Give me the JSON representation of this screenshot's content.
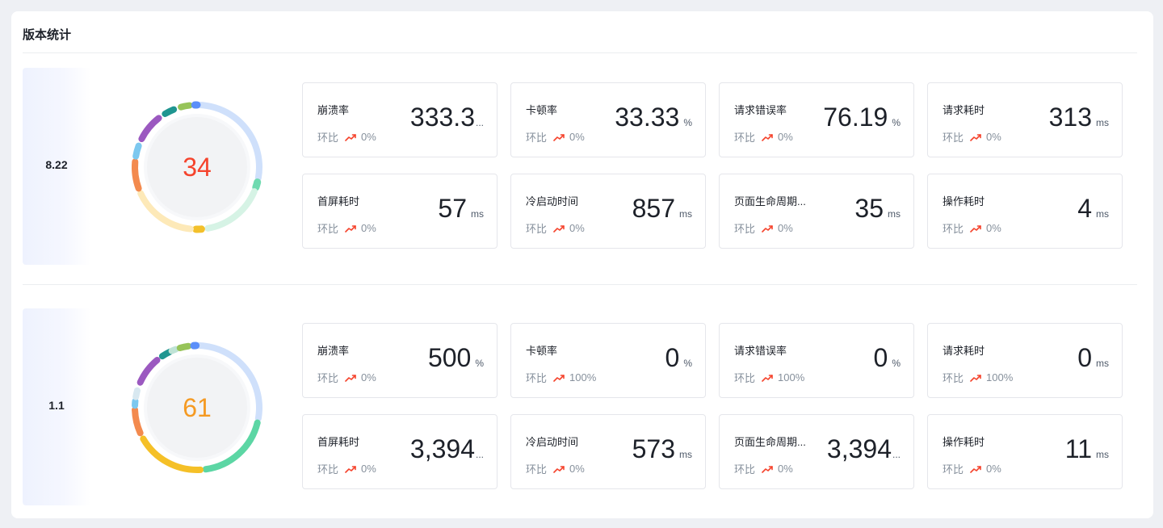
{
  "page": {
    "title": "版本统计",
    "compare_label": "环比"
  },
  "versions": [
    {
      "version": "8.22",
      "score": "34",
      "score_color": "#f5432c",
      "ring_colors": [
        "#cfe0fb",
        "#6fdab0",
        "#d6f3e5",
        "#f3c02a",
        "#fde9b8",
        "#f38a4e",
        "#7cc8ef",
        "#9b59c0",
        "#1f9590",
        "#97c459",
        "#5b8ff9"
      ],
      "metrics": [
        {
          "name": "崩溃率",
          "value": "333.3",
          "unit": "",
          "truncated": true,
          "compare": "0%"
        },
        {
          "name": "卡顿率",
          "value": "33.33",
          "unit": "%",
          "truncated": false,
          "compare": "0%"
        },
        {
          "name": "请求错误率",
          "value": "76.19",
          "unit": "%",
          "truncated": false,
          "compare": "0%"
        },
        {
          "name": "请求耗时",
          "value": "313",
          "unit": "ms",
          "truncated": false,
          "compare": "0%"
        },
        {
          "name": "首屏耗时",
          "value": "57",
          "unit": "ms",
          "truncated": false,
          "compare": "0%"
        },
        {
          "name": "冷启动时间",
          "value": "857",
          "unit": "ms",
          "truncated": false,
          "compare": "0%"
        },
        {
          "name": "页面生命周期...",
          "value": "35",
          "unit": "ms",
          "truncated": false,
          "compare": "0%"
        },
        {
          "name": "操作耗时",
          "value": "4",
          "unit": "ms",
          "truncated": false,
          "compare": "0%"
        }
      ]
    },
    {
      "version": "1.1",
      "score": "61",
      "score_color": "#f59a23",
      "ring_colors": [
        "#cfe0fb",
        "#5cd6a4",
        "#f5c027",
        "#f38a4e",
        "#7cc8ef",
        "#d8e8f0",
        "#9b59c0",
        "#1f9590",
        "#bfe3d6",
        "#97c459",
        "#5b8ff9"
      ],
      "metrics": [
        {
          "name": "崩溃率",
          "value": "500",
          "unit": "%",
          "truncated": false,
          "compare": "0%"
        },
        {
          "name": "卡顿率",
          "value": "0",
          "unit": "%",
          "truncated": false,
          "compare": "100%"
        },
        {
          "name": "请求错误率",
          "value": "0",
          "unit": "%",
          "truncated": false,
          "compare": "100%"
        },
        {
          "name": "请求耗时",
          "value": "0",
          "unit": "ms",
          "truncated": false,
          "compare": "100%"
        },
        {
          "name": "首屏耗时",
          "value": "3,394",
          "unit": "",
          "truncated": true,
          "compare": "0%"
        },
        {
          "name": "冷启动时间",
          "value": "573",
          "unit": "ms",
          "truncated": false,
          "compare": "0%"
        },
        {
          "name": "页面生命周期...",
          "value": "3,394",
          "unit": "",
          "truncated": true,
          "compare": "0%"
        },
        {
          "name": "操作耗时",
          "value": "11",
          "unit": "ms",
          "truncated": false,
          "compare": "0%"
        }
      ]
    }
  ],
  "colors": {
    "trend_up": "#f5432c"
  }
}
